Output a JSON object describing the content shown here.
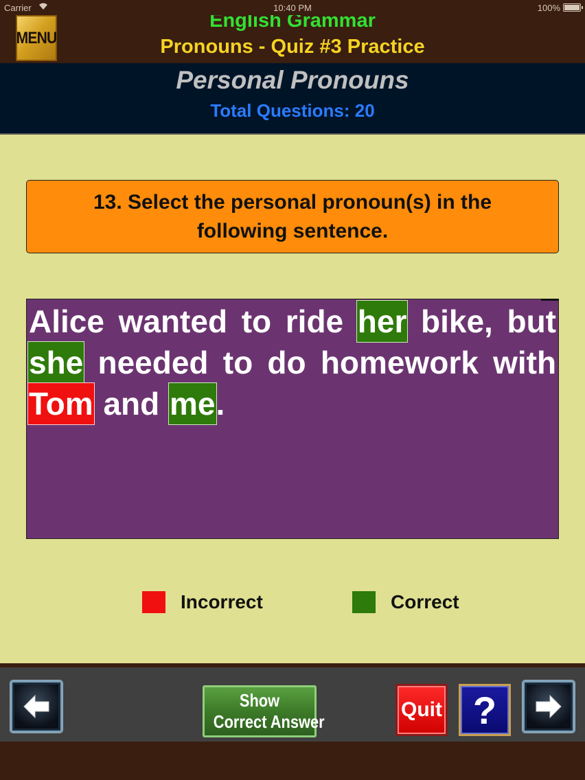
{
  "status_bar": {
    "carrier": "Carrier",
    "time": "10:40 PM",
    "battery": "100%"
  },
  "header": {
    "menu_label": "MENU",
    "app_title": "English Grammar",
    "quiz_title": "Pronouns - Quiz #3 Practice"
  },
  "section": {
    "title": "Personal Pronouns",
    "total_questions": "Total Questions: 20"
  },
  "question": {
    "text": "13. Select the personal pronoun(s) in the following sentence."
  },
  "sentence": {
    "words": [
      {
        "text": "Alice",
        "state": "none"
      },
      {
        "text": "wanted",
        "state": "none"
      },
      {
        "text": "to",
        "state": "none"
      },
      {
        "text": "ride",
        "state": "none"
      },
      {
        "text": "her",
        "state": "correct"
      },
      {
        "text": "bike,",
        "state": "none"
      },
      {
        "text": "but",
        "state": "none"
      },
      {
        "text": "she",
        "state": "correct"
      },
      {
        "text": "needed",
        "state": "none"
      },
      {
        "text": "to",
        "state": "none"
      },
      {
        "text": "do",
        "state": "none"
      },
      {
        "text": "homework",
        "state": "none"
      },
      {
        "text": "with",
        "state": "none"
      },
      {
        "text": "Tom",
        "state": "incorrect"
      },
      {
        "text": "and",
        "state": "none"
      },
      {
        "text": "me",
        "state": "correct"
      },
      {
        "text": ".",
        "state": "punct"
      }
    ]
  },
  "legend": {
    "incorrect_label": "Incorrect",
    "correct_label": "Correct"
  },
  "toolbar": {
    "show_answer_line1": "Show",
    "show_answer_line2": "Correct Answer",
    "quit_label": "Quit",
    "help_label": "?",
    "back_icon": "left-arrow-icon",
    "next_icon": "right-arrow-icon"
  },
  "colors": {
    "correct": "#2e7a0a",
    "incorrect": "#f01010",
    "sentence_bg": "#6b3470",
    "question_bg": "#ff8c0a",
    "content_bg": "#e0e092"
  }
}
